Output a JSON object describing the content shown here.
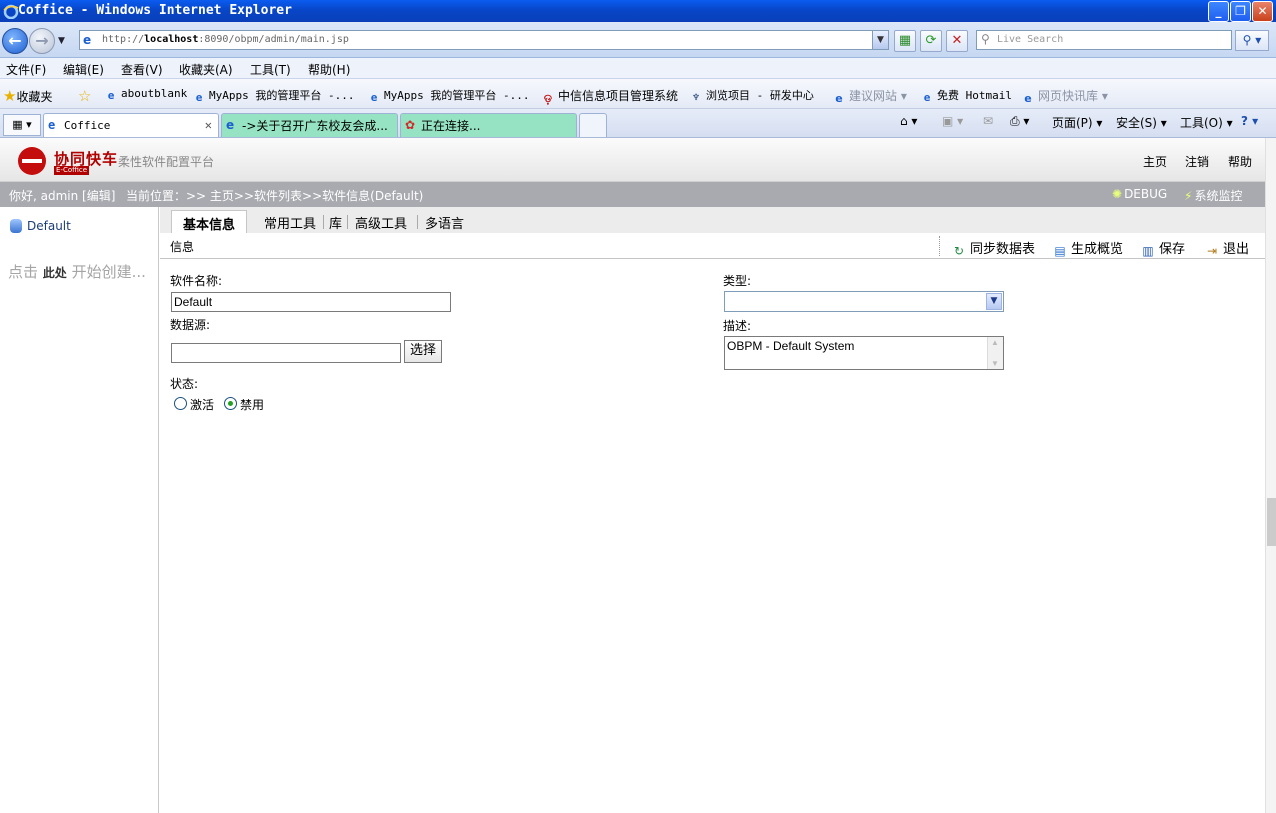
{
  "window": {
    "title": "Coffice - Windows Internet Explorer",
    "url_prefix": "http://",
    "url_host": "localhost",
    "url_rest": ":8090/obpm/admin/main.jsp",
    "search_placeholder": "Live Search"
  },
  "menu": [
    "文件(F)",
    "编辑(E)",
    "查看(V)",
    "收藏夹(A)",
    "工具(T)",
    "帮助(H)"
  ],
  "favorites": {
    "label": "收藏夹",
    "items": [
      "aboutblank",
      "MyApps 我的管理平台 -...",
      "MyApps 我的管理平台 -...",
      "中信信息项目管理系统",
      "浏览项目 - 研发中心",
      "建议网站 ▾",
      "免费 Hotmail",
      "网页快讯库 ▾"
    ]
  },
  "browser_tabs": [
    {
      "label": "Coffice",
      "state": "active"
    },
    {
      "label": "->关于召开广东校友会成...",
      "state": "inactive"
    },
    {
      "label": "正在连接...",
      "state": "inactive"
    }
  ],
  "command_bar": {
    "page": "页面(P) ▾",
    "safety": "安全(S) ▾",
    "tools": "工具(O) ▾"
  },
  "app": {
    "logo_cn": "协同快车",
    "logo_sub": "E-Coffice",
    "logo_text": "柔性软件配置平台",
    "header_links": {
      "home": "主页",
      "logout": "注销",
      "help": "帮助"
    },
    "greeting": "你好, admin [编辑]",
    "breadcrumb": "当前位置：>> 主页>>软件列表>>软件信息(Default)",
    "debug": "DEBUG",
    "monitor": "系统监控"
  },
  "left_panel": {
    "tree_item": "Default",
    "hint_prefix": "点击",
    "hint_link": "此处",
    "hint_suffix": "开始创建..."
  },
  "content_tabs": [
    "基本信息",
    "常用工具",
    "库",
    "高级工具",
    "多语言"
  ],
  "action_bar": {
    "info": "信息",
    "sync": "同步数据表",
    "overview": "生成概览",
    "save": "保存",
    "exit": "退出"
  },
  "form": {
    "name_label": "软件名称:",
    "name_value": "Default",
    "datasource_label": "数据源:",
    "datasource_value": "",
    "choose_button": "选择",
    "status_label": "状态:",
    "status_options": [
      {
        "label": "激活",
        "checked": false
      },
      {
        "label": "禁用",
        "checked": true
      }
    ],
    "type_label": "类型:",
    "type_value": "",
    "desc_label": "描述:",
    "desc_value": "OBPM - Default System"
  },
  "colors": {
    "brand_red": "#c40d0d",
    "band_gray": "#a8aaaf",
    "ie_blue": "#0a5cf0"
  }
}
